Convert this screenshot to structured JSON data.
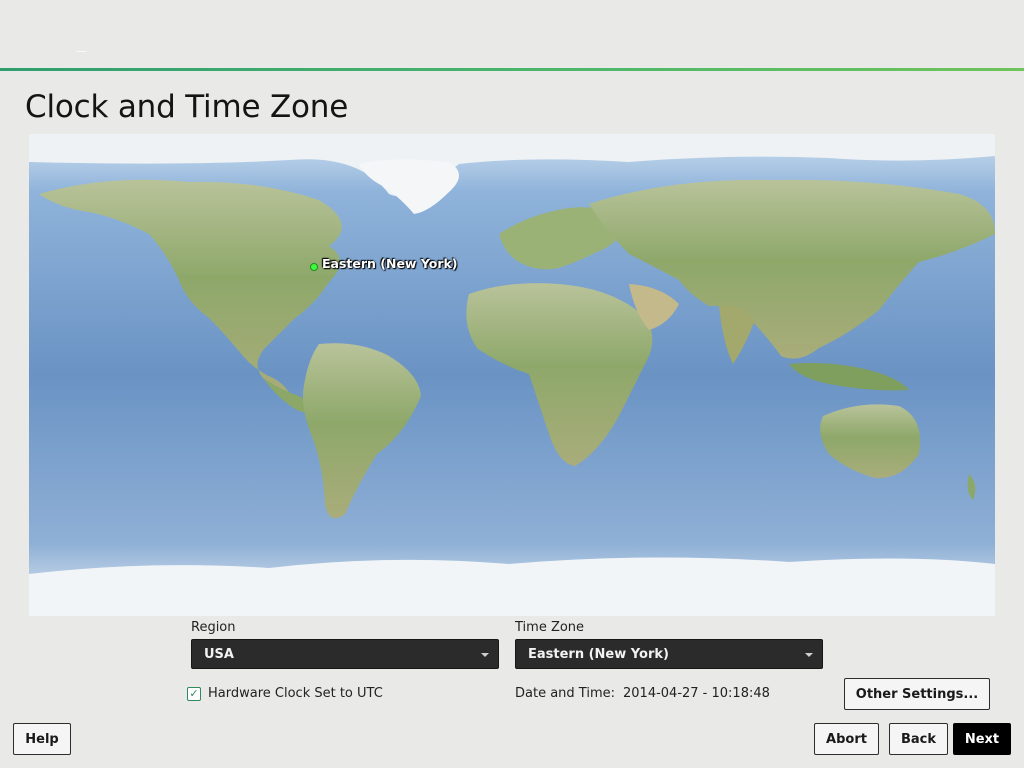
{
  "page": {
    "title": "Clock and Time Zone"
  },
  "map": {
    "selected_label": "Eastern (New York)",
    "marker_color": "#3dff3d"
  },
  "region": {
    "label": "Region",
    "value": "USA"
  },
  "timezone": {
    "label": "Time Zone",
    "value": "Eastern (New York)"
  },
  "hardware_clock": {
    "label": "Hardware Clock Set to UTC",
    "checked": true,
    "check_mark": "✓"
  },
  "datetime": {
    "label": "Date and Time:",
    "value": "2014-04-27 - 10:18:48"
  },
  "buttons": {
    "other_settings": "Other Settings...",
    "help": "Help",
    "abort": "Abort",
    "back": "Back",
    "next": "Next"
  },
  "colors": {
    "accent": "#4fb86a",
    "primary_button": "#000000",
    "select_bg": "#2a2b2a"
  }
}
